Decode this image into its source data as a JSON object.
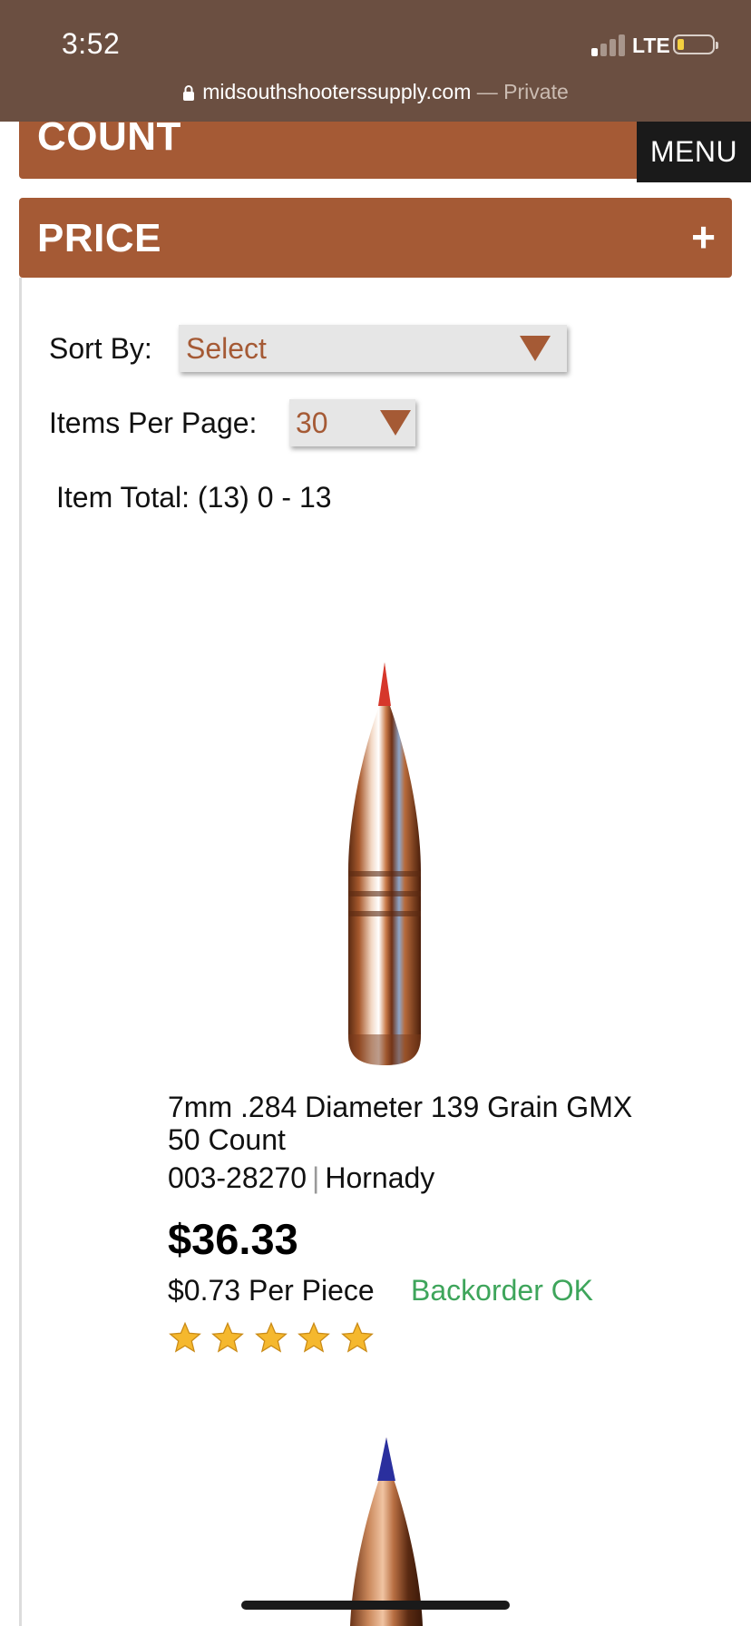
{
  "status_bar": {
    "time": "3:52",
    "network": "LTE",
    "battery_level": 0.15,
    "url": "midsouthshooterssupply.com",
    "url_separator": "—",
    "private_label": "Private"
  },
  "filters": {
    "count_label": "COUNT",
    "price_label": "PRICE",
    "price_toggle": "+"
  },
  "menu_label": "MENU",
  "sort": {
    "label": "Sort By:",
    "value": "Select"
  },
  "items_per_page": {
    "label": "Items Per Page:",
    "value": "30"
  },
  "item_total": "Item Total: (13) 0 - 13",
  "products": [
    {
      "name": "7mm .284 Diameter 139 Grain GMX 50 Count",
      "sku": "003-28270",
      "sku_separator": "|",
      "brand": "Hornady",
      "price": "$36.33",
      "per_piece": "$0.73 Per Piece",
      "availability": "Backorder OK",
      "rating": 5,
      "rating_max": 5,
      "image": "copper-bullet-red-tip"
    },
    {
      "image": "copper-bullet-blue-tip"
    }
  ],
  "colors": {
    "accent": "#a55a35",
    "status_bar": "#6b4f41",
    "availability": "#3ea55b",
    "star": "#f5b82e"
  }
}
